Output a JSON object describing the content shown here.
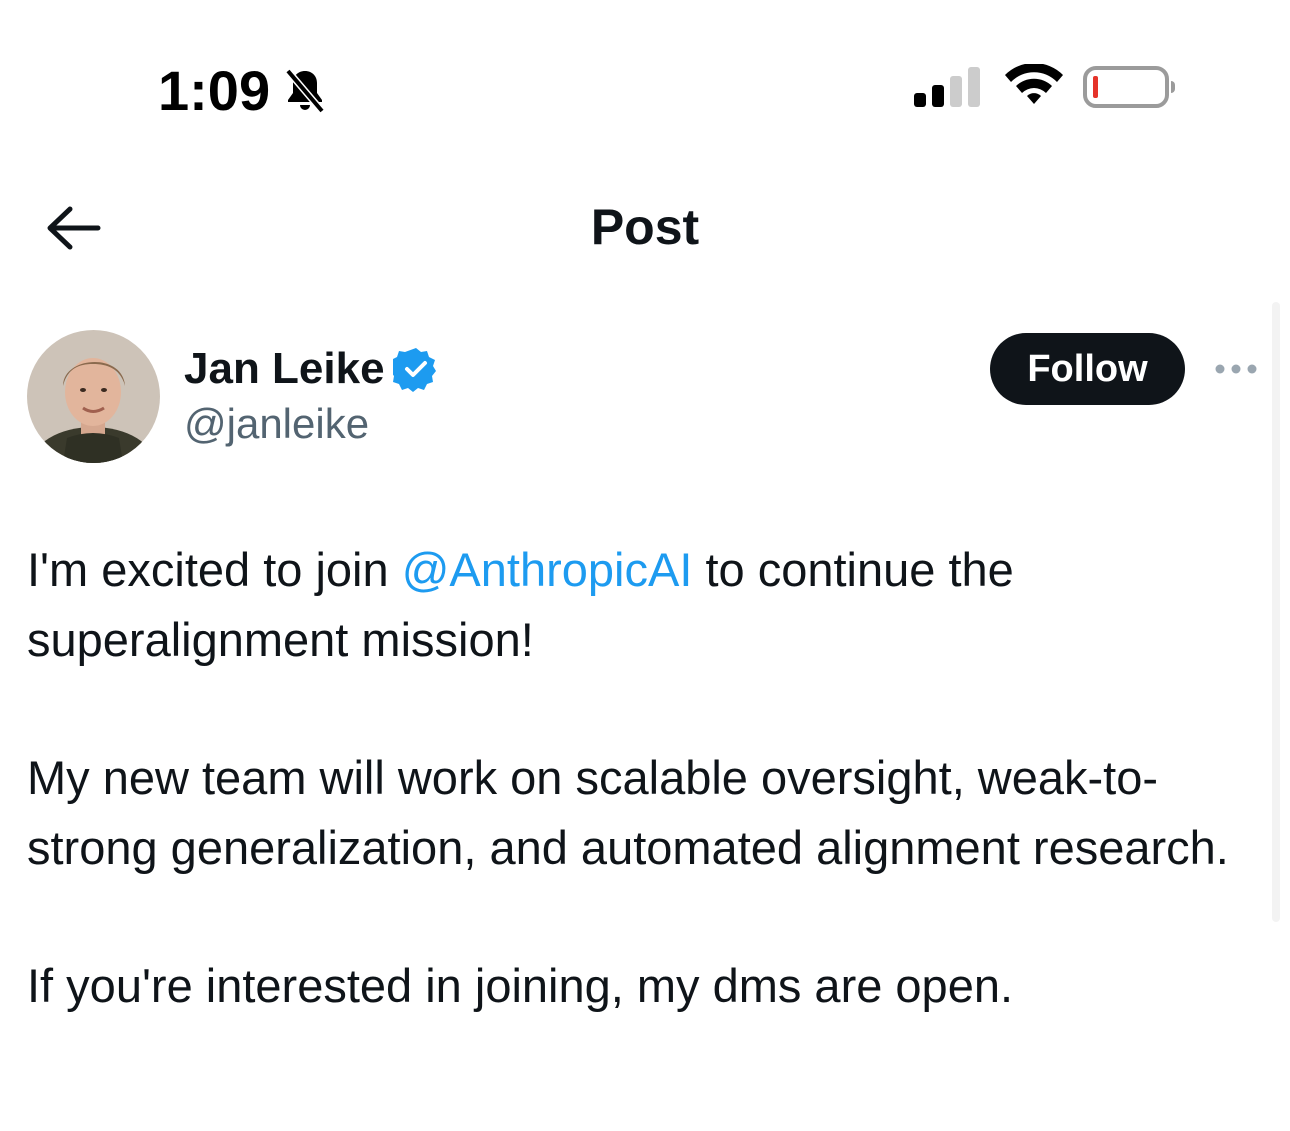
{
  "status_bar": {
    "time": "1:09",
    "icons": [
      "bell-slash-icon",
      "cellular-signal-icon",
      "wifi-icon",
      "battery-low-icon"
    ],
    "battery_color": "#e5332a"
  },
  "header": {
    "back_icon": "arrow-left-icon",
    "title": "Post"
  },
  "post": {
    "author": {
      "name": "Jan Leike",
      "handle": "@janleike",
      "verified": true,
      "verified_color": "#1d9bf0"
    },
    "follow_label": "Follow",
    "more_icon": "ellipsis-icon",
    "text": {
      "p1_before": "I'm excited to join ",
      "p1_mention": "@AnthropicAI",
      "p1_after": " to continue the superalignment mission!",
      "p2": "My new team will work on scalable oversight, weak-to-strong generalization, and automated alignment research.",
      "p3": "If you're interested in joining, my dms are open."
    }
  },
  "colors": {
    "text_primary": "#0f1419",
    "text_secondary": "#536471",
    "accent": "#1d9bf0",
    "follow_bg": "#0f1419"
  }
}
